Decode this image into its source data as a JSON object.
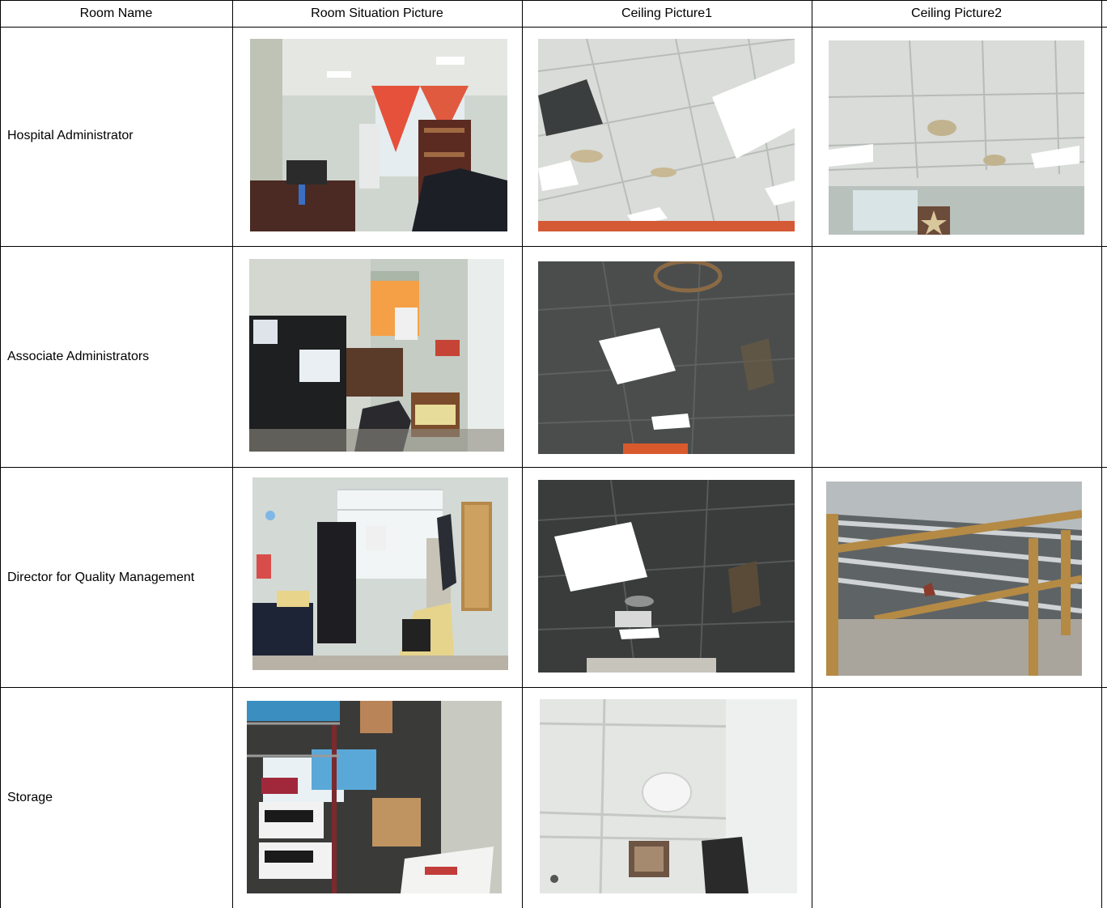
{
  "table": {
    "headers": [
      "Room Name",
      "Room Situation Picture",
      "Ceiling Picture1",
      "Ceiling Picture2"
    ],
    "rows": [
      {
        "room": "Hospital Administrator",
        "photos": [
          "office-room-photo",
          "ceiling-photo",
          "ceiling-photo"
        ]
      },
      {
        "room": "Associate Administrators",
        "photos": [
          "office-room-photo",
          "ceiling-photo",
          ""
        ]
      },
      {
        "room": "Director for Quality Management",
        "photos": [
          "office-room-photo",
          "ceiling-photo",
          "exposed-ceiling-structure-photo"
        ]
      },
      {
        "room": "Storage",
        "photos": [
          "storage-room-photo",
          "ceiling-photo",
          ""
        ]
      }
    ]
  }
}
